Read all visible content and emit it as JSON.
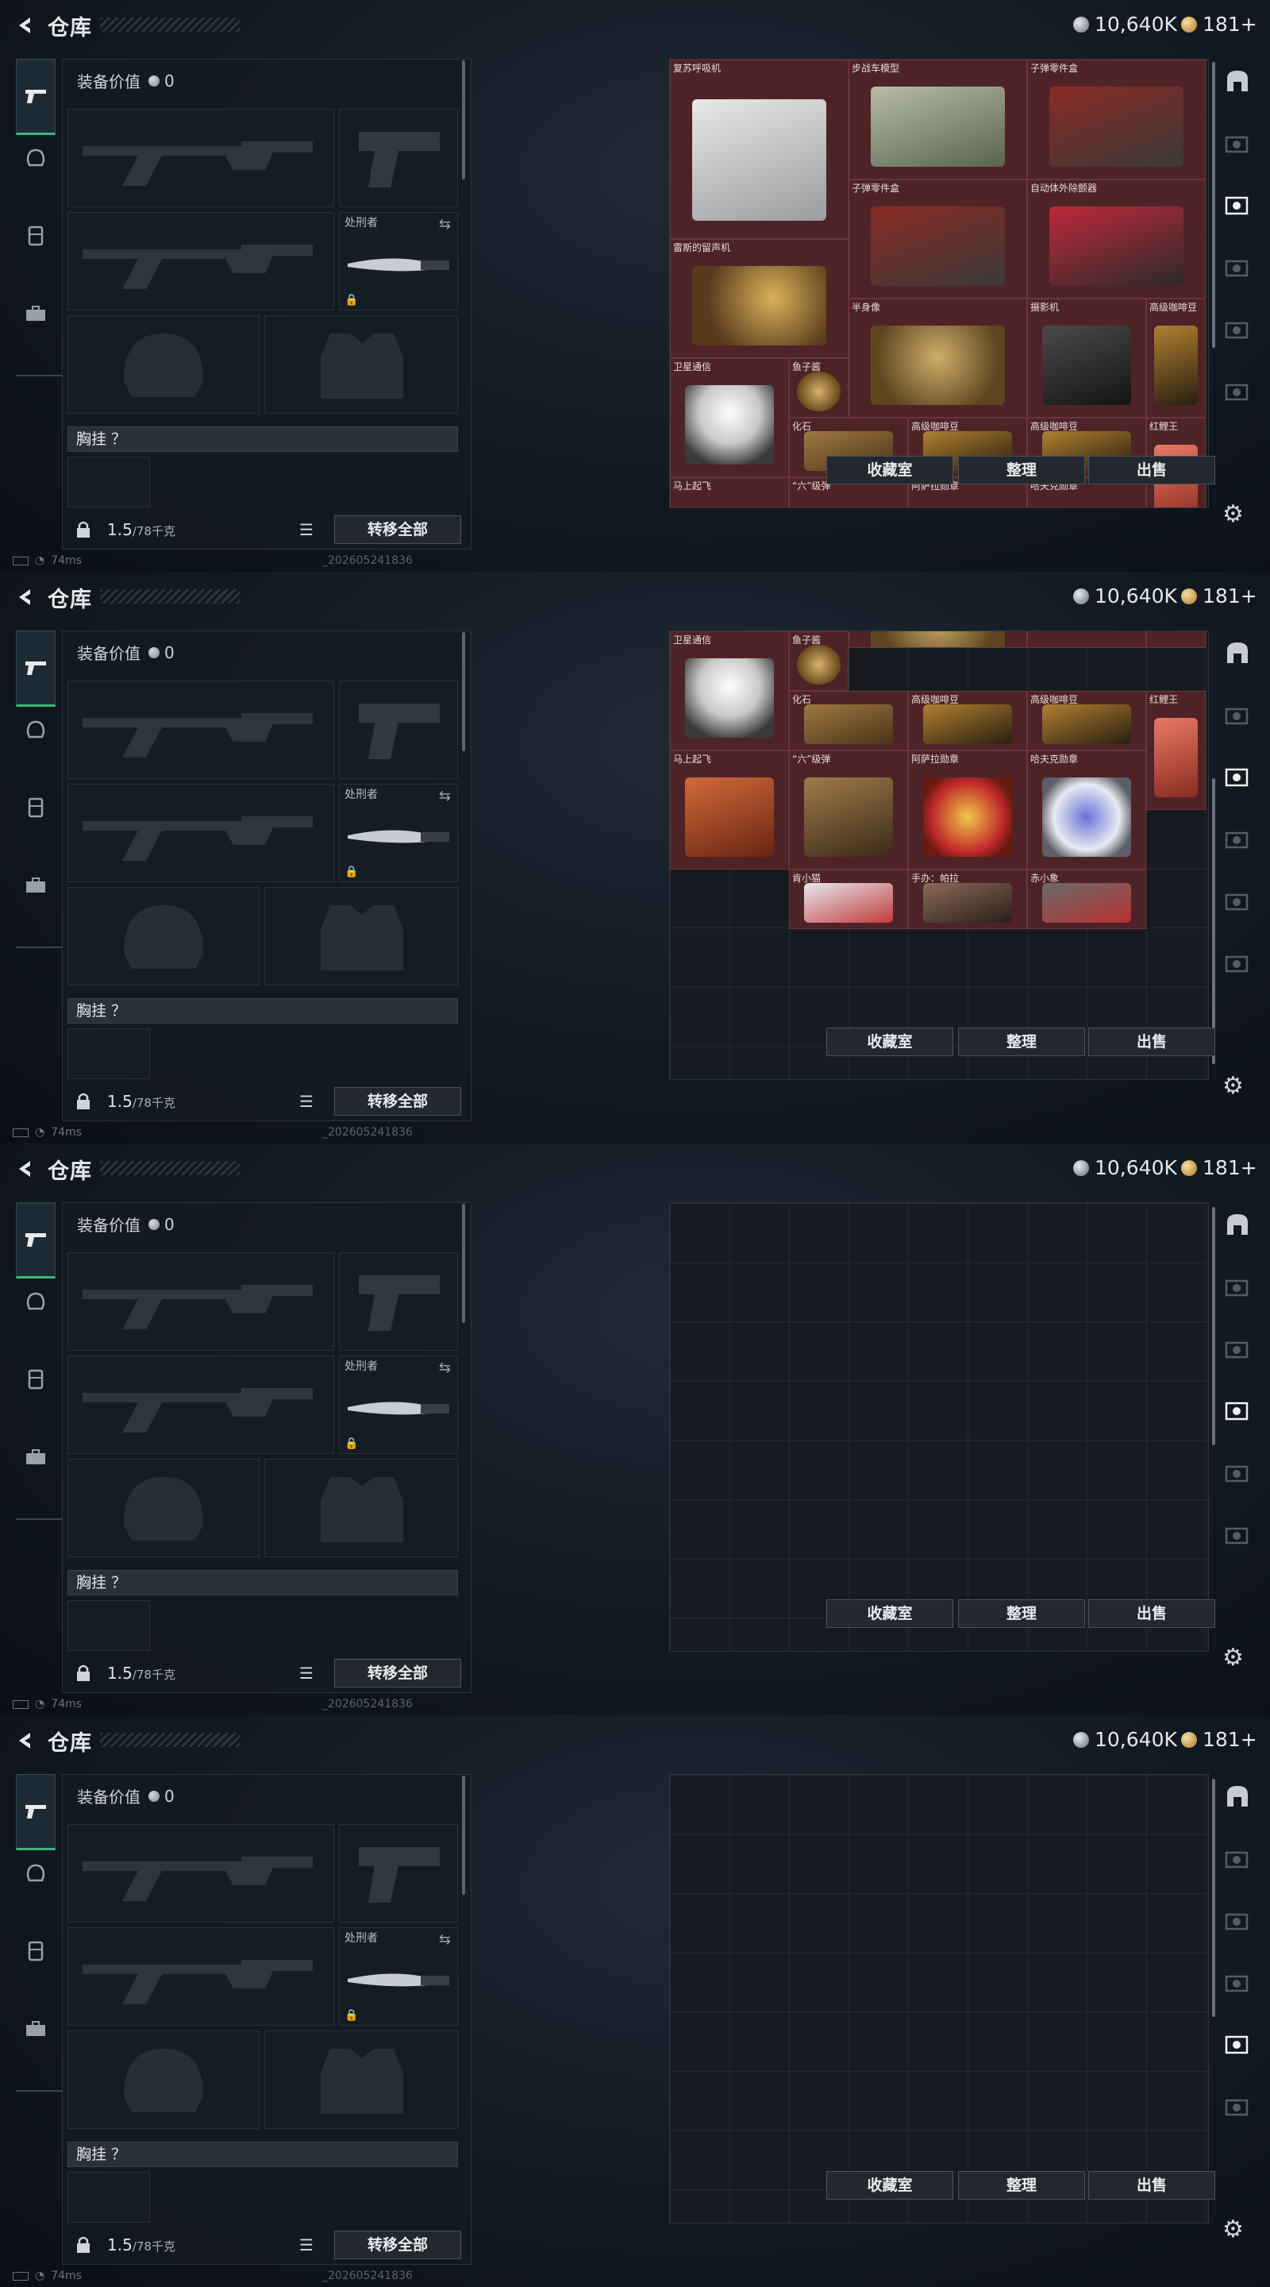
{
  "header": {
    "title": "仓库",
    "currency_silver": "10,640K",
    "currency_gold": "181+"
  },
  "equip": {
    "value_label": "装备价值",
    "value": "0",
    "executioner_label": "处刑者",
    "chest_label": "胸挂 ？",
    "weight_value": "1.5",
    "weight_max": "/78千克",
    "transfer_button": "转移全部"
  },
  "buttons": {
    "collection": "收藏室",
    "sort": "整理",
    "sell": "出售"
  },
  "status": {
    "ping": "74ms",
    "version": "_202605241836"
  },
  "nav_icons": [
    "pistol-icon",
    "helmet-icon",
    "vest-icon",
    "case-icon"
  ],
  "right_icons": [
    "arch-icon",
    "stash-tab-2-icon",
    "stash-tab-3-icon",
    "stash-tab-4-icon",
    "stash-tab-5-icon",
    "stash-tab-6-icon",
    "stash-tab-7-icon"
  ],
  "items": {
    "revive": "复苏呼吸机",
    "ifv": "步战车模型",
    "ammo_parts": "子弹零件盒",
    "defib": "自动体外除颤器",
    "gramophone": "雷斯的留声机",
    "bust": "半身像",
    "camera": "摄影机",
    "coffee": "高级咖啡豆",
    "satcom": "卫星通信",
    "fish_eye": "鱼子酱",
    "fossil": "化石",
    "red_carp": "红鲤王",
    "horse": "马上起飞",
    "six_bullet": "“六”级弹",
    "asala_medal": "阿萨拉勋章",
    "hafk_medal": "哈夫克勋章",
    "xiaoxiao": "肯小猫",
    "figure_pala": "手办：帕拉",
    "chixiaoxiang": "赤小象"
  },
  "colors": {
    "accent_green": "#3fb67d",
    "item_bg": "#4e2327"
  }
}
